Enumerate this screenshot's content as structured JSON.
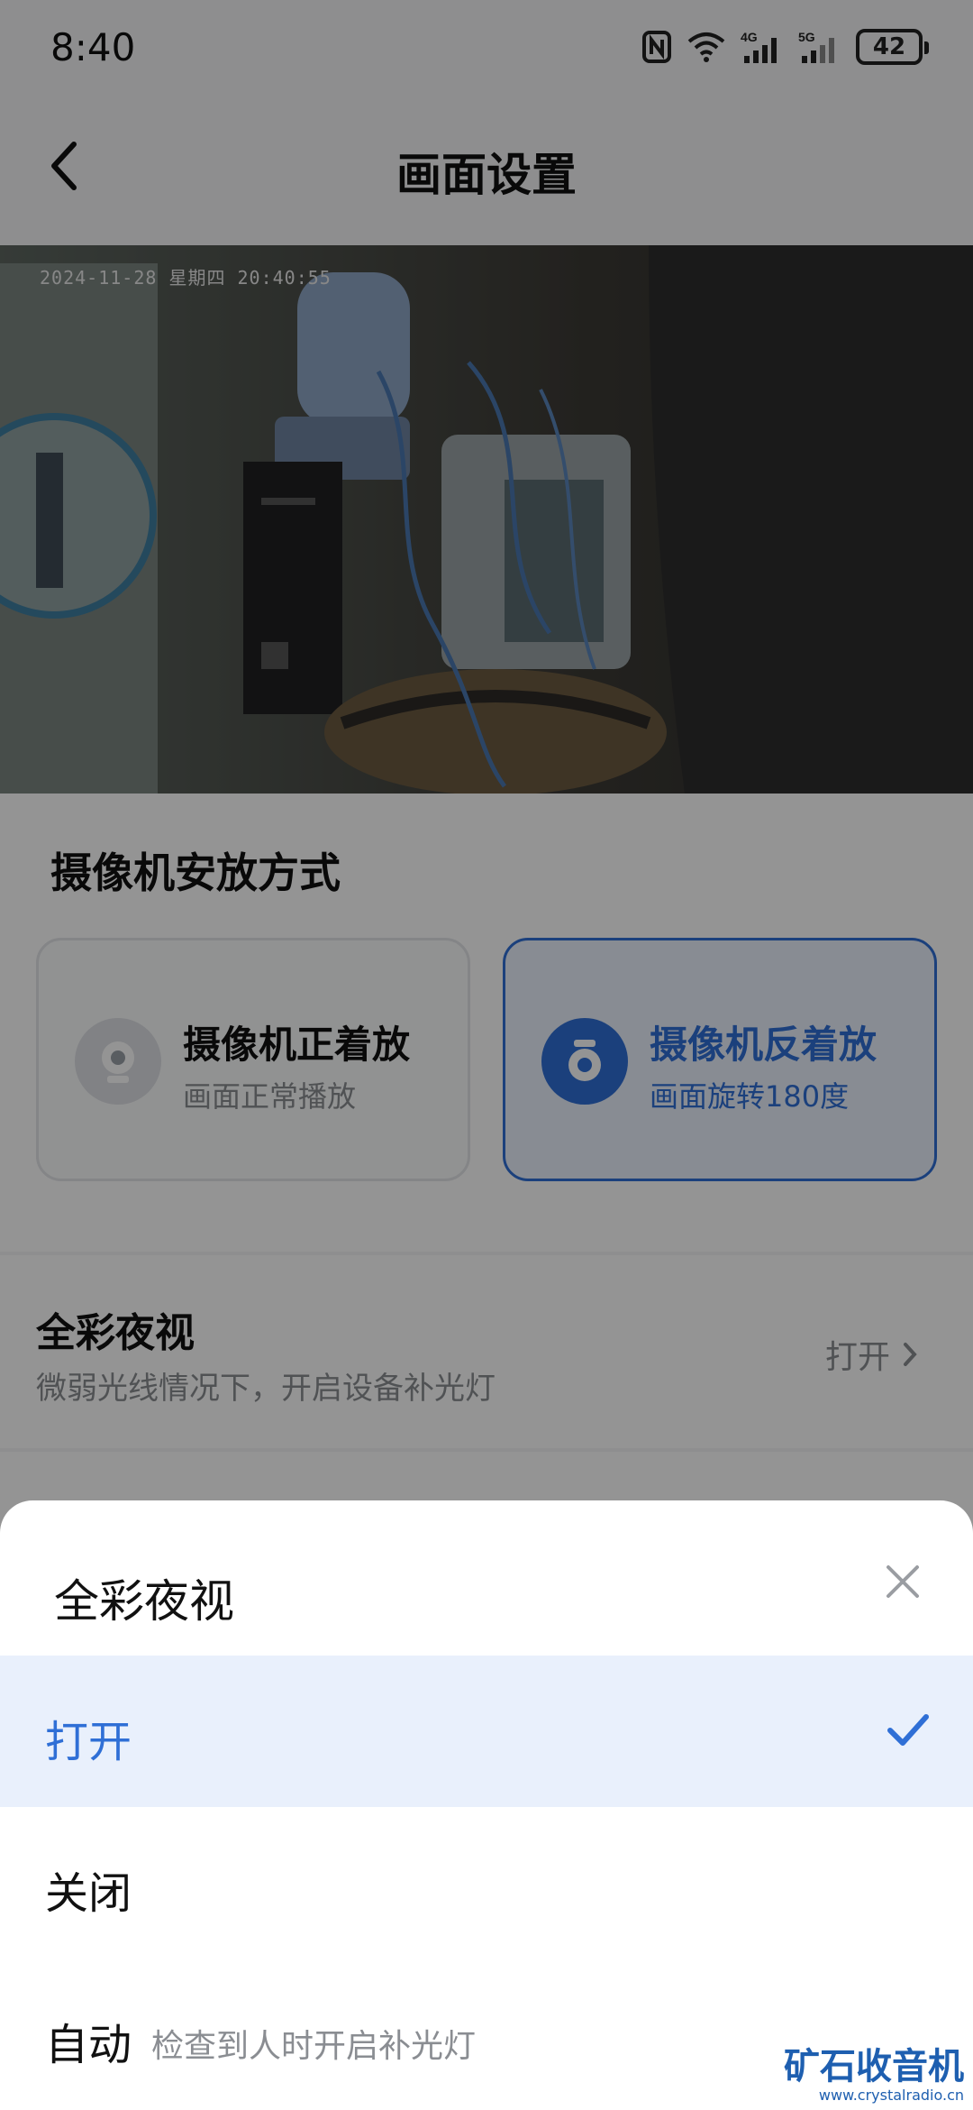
{
  "status_bar": {
    "time": "8:40",
    "battery": "42",
    "network_1": "4G",
    "network_2": "5G"
  },
  "header": {
    "title": "画面设置"
  },
  "camera": {
    "osd_text": "2024-11-28 星期四 20:40:55"
  },
  "mount": {
    "title": "摄像机安放方式",
    "options": [
      {
        "label": "摄像机正着放",
        "sub": "画面正常播放",
        "selected": false
      },
      {
        "label": "摄像机反着放",
        "sub": "画面旋转180度",
        "selected": true
      }
    ]
  },
  "night_vision": {
    "title": "全彩夜视",
    "desc": "微弱光线情况下，开启设备补光灯",
    "value": "打开"
  },
  "sheet": {
    "title": "全彩夜视",
    "options": [
      {
        "label": "打开",
        "desc": "",
        "selected": true
      },
      {
        "label": "关闭",
        "desc": "",
        "selected": false
      },
      {
        "label": "自动",
        "desc": "检查到人时开启补光灯",
        "selected": false
      }
    ]
  },
  "watermark": {
    "brand": "矿石收音机",
    "site": "www.crystalradio.cn"
  },
  "colors": {
    "accent": "#2f6fd6",
    "overlay": "rgba(0,0,0,0.42)",
    "selected_bg": "#e9f0fc"
  }
}
